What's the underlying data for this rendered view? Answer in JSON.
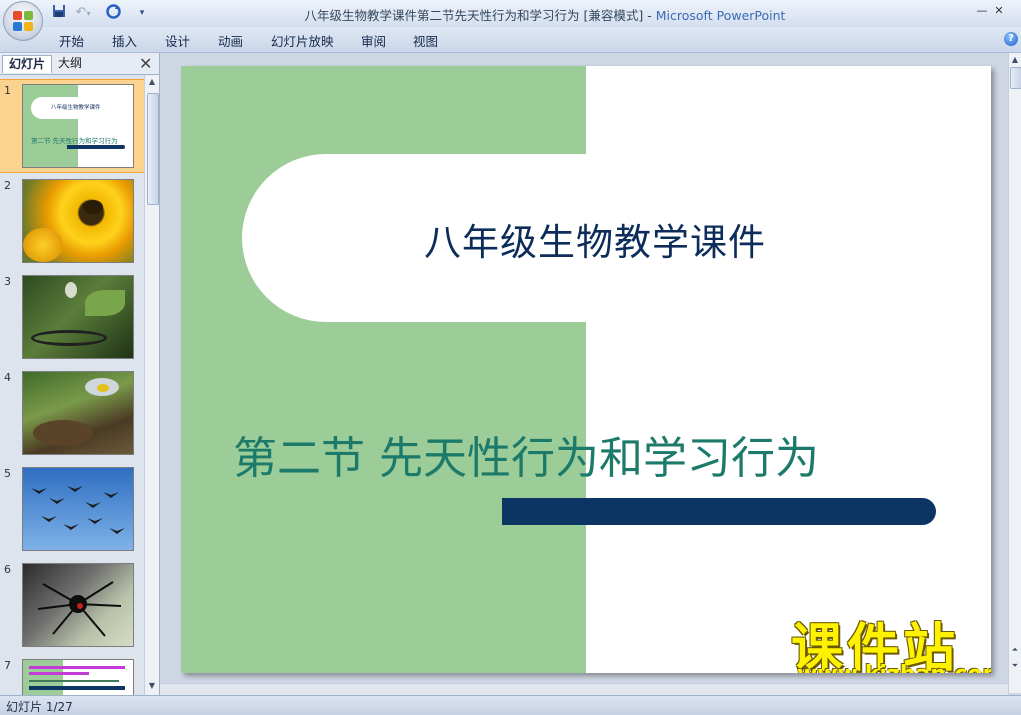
{
  "window": {
    "title": "八年级生物教学课件第二节先天性行为和学习行为 [兼容模式]",
    "app_name": "Microsoft PowerPoint",
    "separator": " - "
  },
  "quick_access": {
    "save_icon": "save-icon",
    "undo_icon": "undo-icon",
    "redo_icon": "redo-icon",
    "dropdown": "▾"
  },
  "ribbon": {
    "tabs": [
      "开始",
      "插入",
      "设计",
      "动画",
      "幻灯片放映",
      "审阅",
      "视图"
    ]
  },
  "pane": {
    "tabs": [
      "幻灯片",
      "大纲"
    ],
    "close": "✕"
  },
  "thumbnails": [
    {
      "num": "1",
      "title": "八年级生物教学课件",
      "subtitle": "第二节  先天性行为和学习行为"
    },
    {
      "num": "2",
      "desc": "bee-on-sunflower"
    },
    {
      "num": "3",
      "desc": "cobra"
    },
    {
      "num": "4",
      "desc": "bird-feeding-nest"
    },
    {
      "num": "5",
      "desc": "geese-flying"
    },
    {
      "num": "6",
      "desc": "spider"
    },
    {
      "num": "7"
    }
  ],
  "slide": {
    "title": "八年级生物教学课件",
    "subtitle": "第二节  先天性行为和学习行为",
    "colors": {
      "green": "#9ccc97",
      "navy": "#0c3564",
      "title": "#0c2d5a",
      "subtitle": "#1c7a6b"
    }
  },
  "watermark": {
    "cn": "课件站",
    "url": "www.kjzhan.com"
  },
  "status": {
    "text": "幻灯片 1/27"
  }
}
